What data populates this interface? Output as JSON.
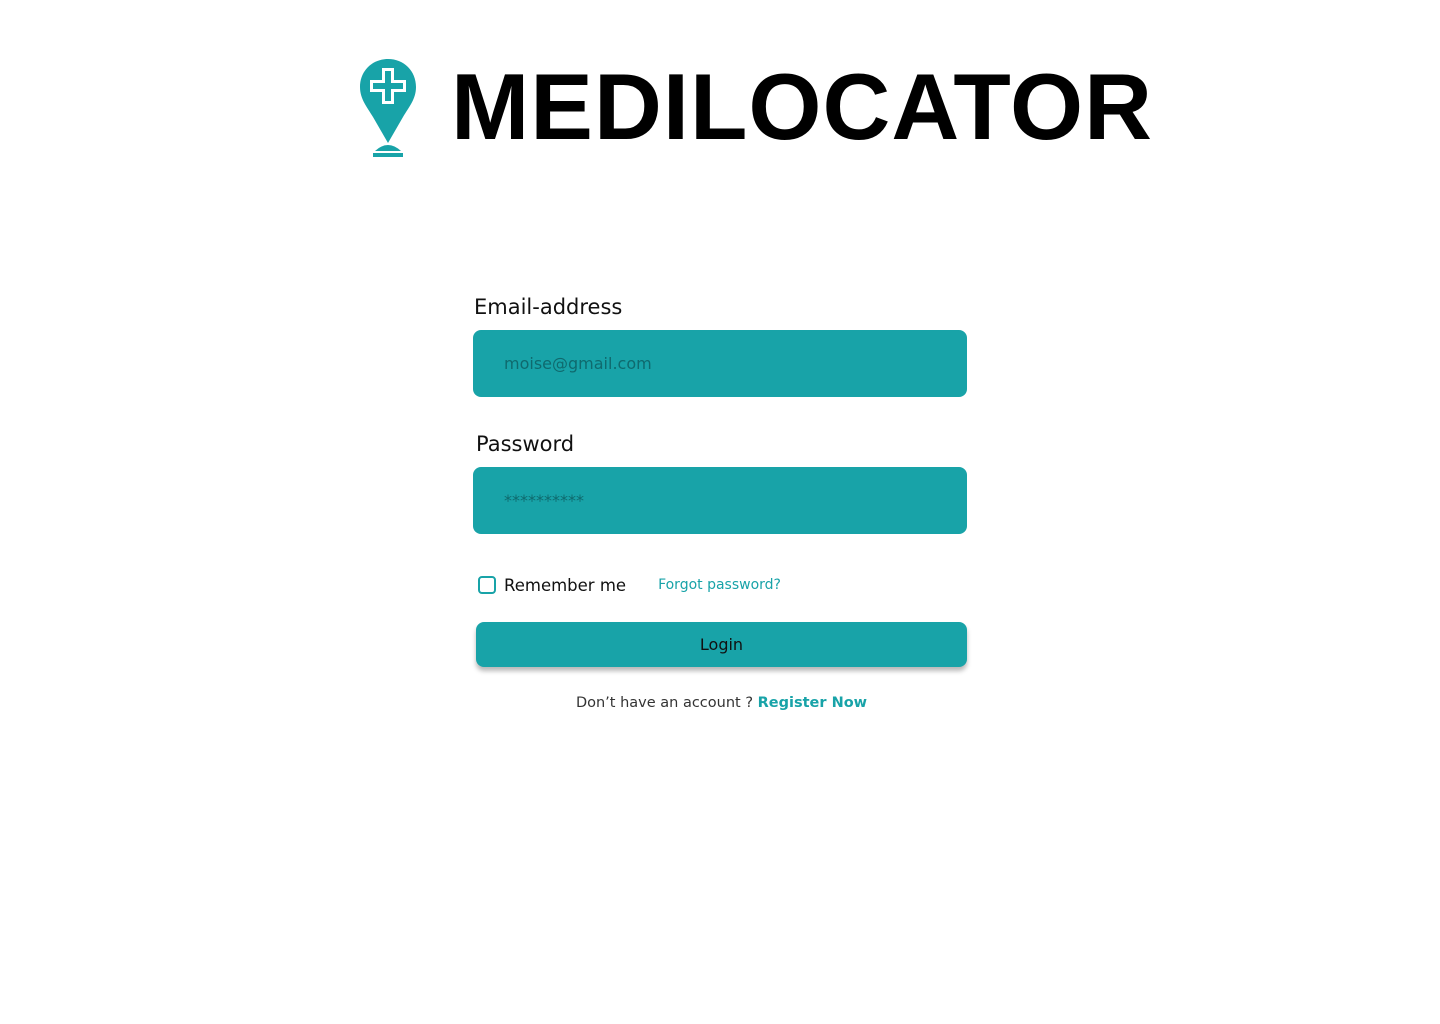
{
  "brand": {
    "title": "MEDILOCATOR",
    "logo_icon": "medical-location-pin-icon",
    "accent_color": "#18a3a8"
  },
  "form": {
    "email_label": "Email-address",
    "email_placeholder": "moise@gmail.com",
    "password_label": "Password",
    "password_placeholder": "**********",
    "remember_label": "Remember me",
    "remember_checked": false,
    "forgot_label": "Forgot password?",
    "login_label": "Login",
    "register_prompt": "Don’t have an account ?",
    "register_link": "Register Now"
  }
}
